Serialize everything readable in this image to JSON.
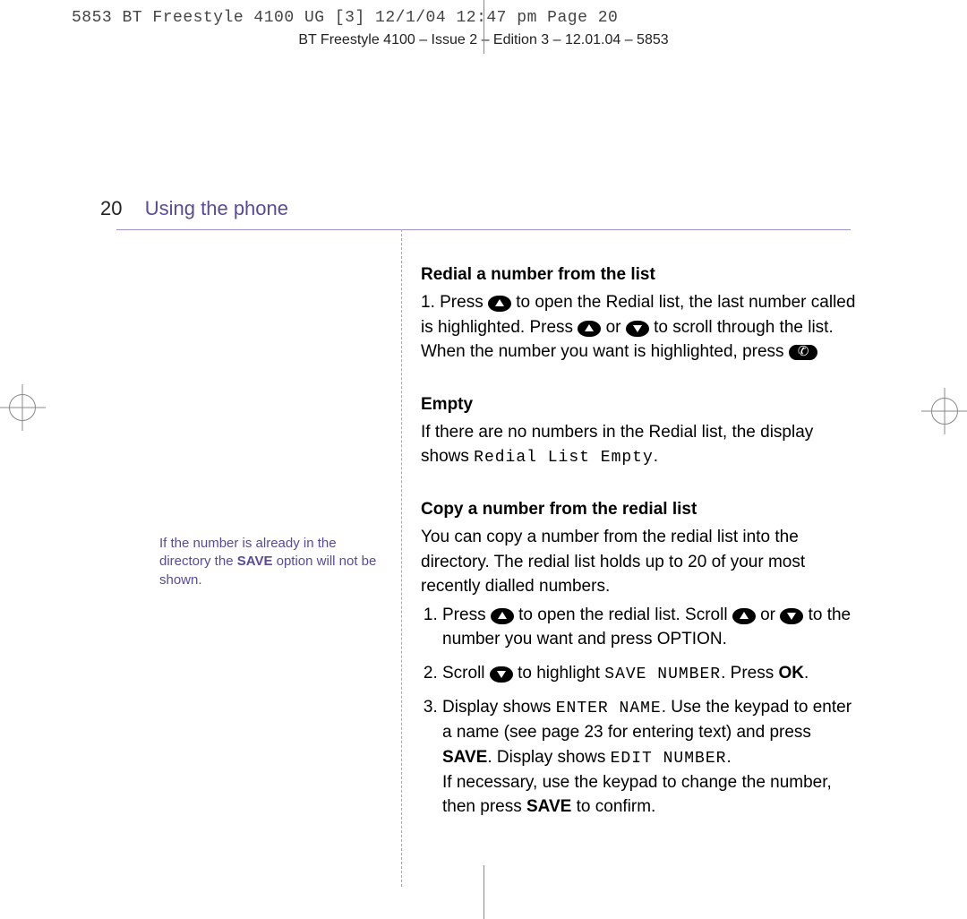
{
  "slugline": "5853 BT Freestyle 4100 UG [3]  12/1/04  12:47 pm  Page 20",
  "running_head": "BT Freestyle 4100 – Issue 2 – Edition 3 – 12.01.04 – 5853",
  "page_number": "20",
  "section": "Using the phone",
  "sidebar": {
    "note_pre": "If the number is already in the directory the ",
    "note_bold": "SAVE",
    "note_post": " option will not be shown."
  },
  "body": {
    "h1": "Redial a number from the list",
    "p1a": "1.  Press ",
    "p1b": " to open the Redial list, the last number called is highlighted. Press ",
    "p1c": " or ",
    "p1d": " to scroll through the list. When the number you want is highlighted, press ",
    "h2": "Empty",
    "p2a": "If there are no numbers in the Redial list, the display shows ",
    "p2lcd": "Redial List Empty",
    "p2b": ".",
    "h3": "Copy a number from the redial list",
    "p3": "You can copy a number from the redial list into the directory. The redial list holds up to 20 of your most recently dialled numbers.",
    "s1a": "Press ",
    "s1b": " to open the redial list. Scroll ",
    "s1c": " or ",
    "s1d": " to the number you want and press OPTION.",
    "s2a": "Scroll ",
    "s2b": " to highlight ",
    "s2lcd": "SAVE NUMBER",
    "s2c": ". Press ",
    "s2ok": "OK",
    "s2d": ".",
    "s3a": "Display shows ",
    "s3lcd1": "ENTER NAME",
    "s3b": ". Use the keypad to enter a name (see page 23 for entering text) and press ",
    "s3save": "SAVE",
    "s3c": ". Display shows ",
    "s3lcd2": "EDIT NUMBER",
    "s3d": ".",
    "s3e": "If necessary, use the keypad to change the number, then press ",
    "s3save2": "SAVE",
    "s3f": " to confirm."
  }
}
